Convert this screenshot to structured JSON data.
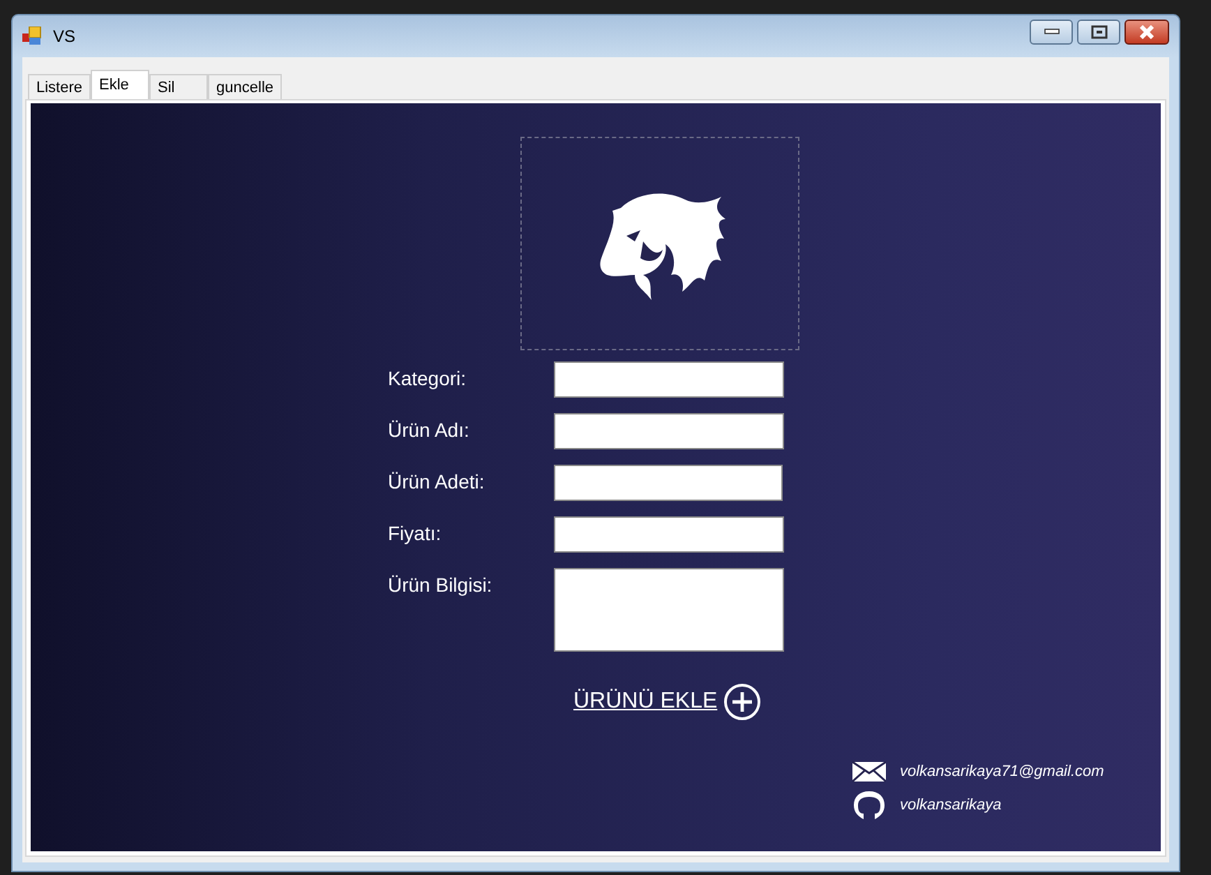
{
  "window": {
    "title": "VS"
  },
  "tabs": [
    {
      "label": "Listere",
      "selected": false
    },
    {
      "label": "Ekle",
      "selected": true
    },
    {
      "label": "Sil",
      "selected": false
    },
    {
      "label": "guncelle",
      "selected": false
    }
  ],
  "form": {
    "fields": [
      {
        "label": "Kategori:",
        "kind": "line"
      },
      {
        "label": "Ürün Adı:",
        "kind": "line"
      },
      {
        "label": "Ürün Adeti:",
        "kind": "line"
      },
      {
        "label": "Fiyatı:",
        "kind": "line"
      },
      {
        "label": "Ürün Bilgisi:",
        "kind": "multiline"
      }
    ],
    "submit": "ÜRÜNÜ EKLE"
  },
  "contacts": [
    {
      "kind": "email",
      "text": "volkansarikaya71@gmail.com"
    },
    {
      "kind": "github",
      "text": "volkansarikaya"
    }
  ]
}
